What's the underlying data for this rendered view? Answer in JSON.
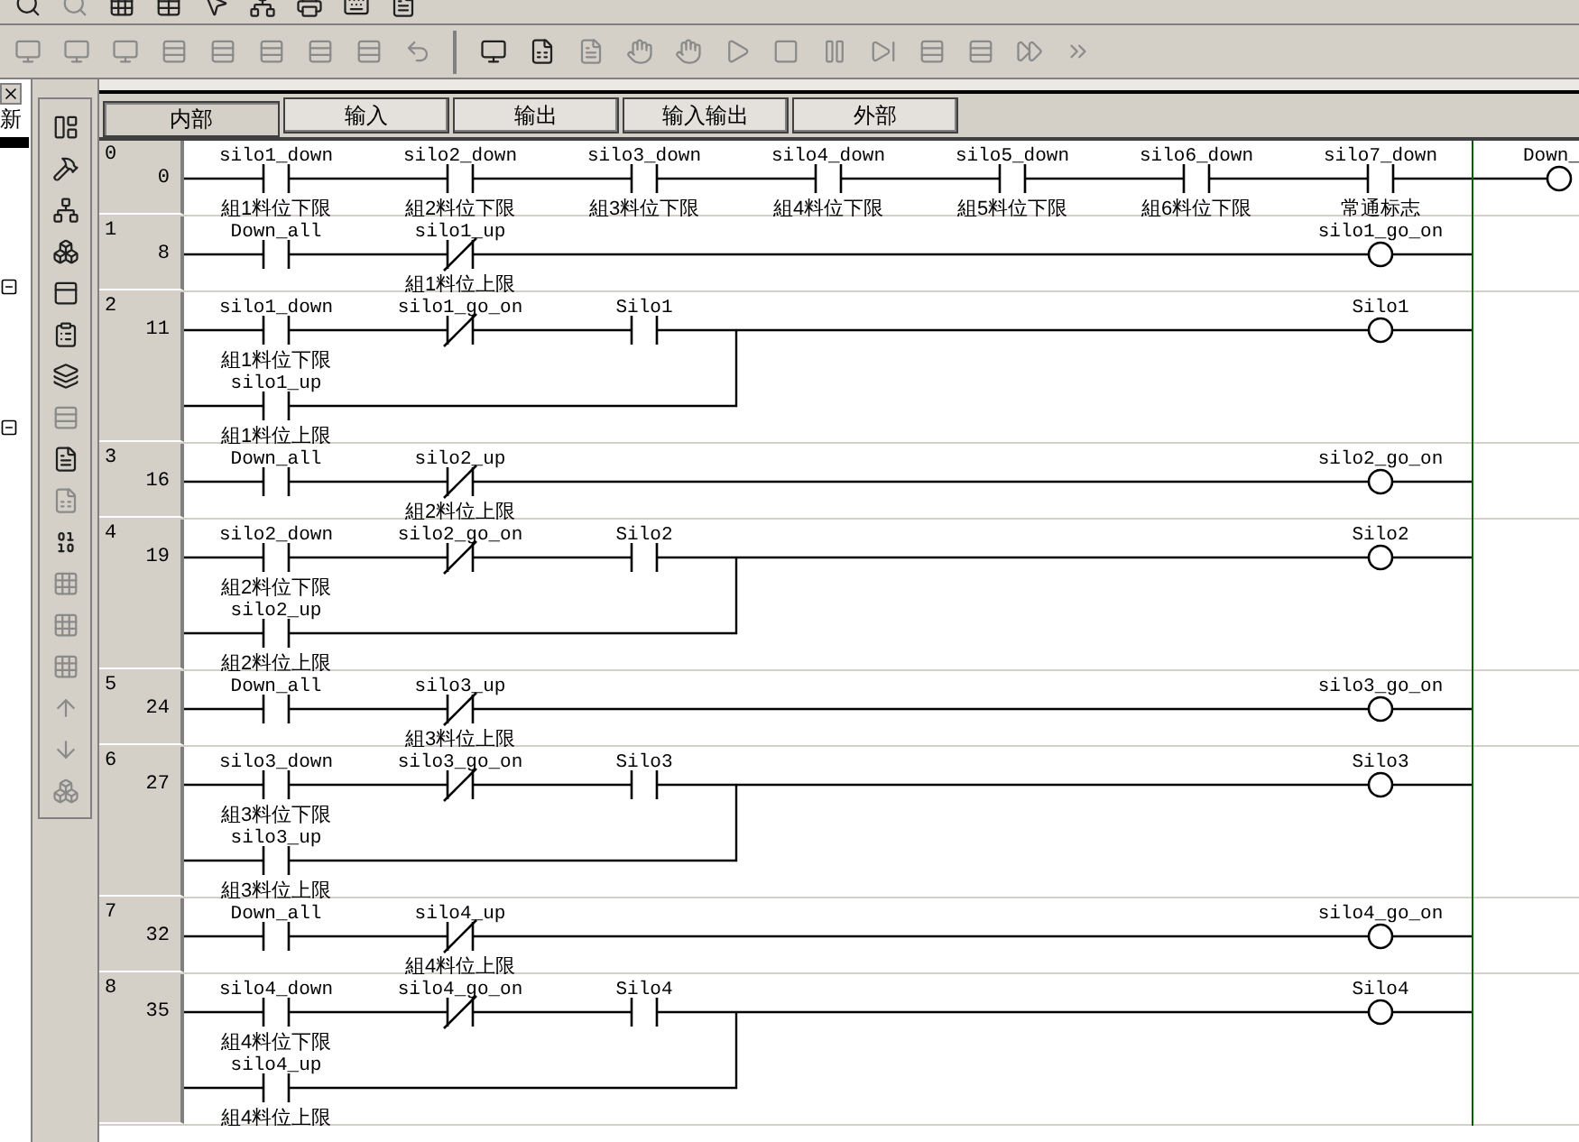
{
  "left_panel": {
    "label": "新"
  },
  "tabs": [
    {
      "label": "内部",
      "selected": true
    },
    {
      "label": "输入",
      "selected": false
    },
    {
      "label": "输出",
      "selected": false
    },
    {
      "label": "输入输出",
      "selected": false
    },
    {
      "label": "外部",
      "selected": false
    }
  ],
  "rungs": [
    {
      "number": "0",
      "step": "0",
      "contacts": [
        {
          "kind": "no",
          "label": "silo1_down",
          "comment": "組1料位下限"
        },
        {
          "kind": "no",
          "label": "silo2_down",
          "comment": "組2料位下限"
        },
        {
          "kind": "no",
          "label": "silo3_down",
          "comment": "組3料位下限"
        },
        {
          "kind": "no",
          "label": "silo4_down",
          "comment": "組4料位下限"
        },
        {
          "kind": "no",
          "label": "silo5_down",
          "comment": "組5料位下限"
        },
        {
          "kind": "no",
          "label": "silo6_down",
          "comment": "組6料位下限"
        },
        {
          "kind": "no",
          "label": "silo7_down",
          "comment": "常通标志"
        }
      ],
      "coil": {
        "label": "Down_"
      }
    },
    {
      "number": "1",
      "step": "8",
      "contacts": [
        {
          "kind": "no",
          "label": "Down_all"
        },
        {
          "kind": "nc",
          "label": "silo1_up",
          "comment": "組1料位上限"
        }
      ],
      "coil": {
        "label": "silo1_go_on"
      }
    },
    {
      "number": "2",
      "step": "11",
      "contacts": [
        {
          "kind": "no",
          "label": "silo1_down",
          "comment": "組1料位下限"
        },
        {
          "kind": "nc",
          "label": "silo1_go_on"
        },
        {
          "kind": "no",
          "label": "Silo1"
        }
      ],
      "branch": {
        "kind": "no",
        "label": "silo1_up",
        "comment": "組1料位上限"
      },
      "coil": {
        "label": "Silo1"
      }
    },
    {
      "number": "3",
      "step": "16",
      "contacts": [
        {
          "kind": "no",
          "label": "Down_all"
        },
        {
          "kind": "nc",
          "label": "silo2_up",
          "comment": "組2料位上限"
        }
      ],
      "coil": {
        "label": "silo2_go_on"
      }
    },
    {
      "number": "4",
      "step": "19",
      "contacts": [
        {
          "kind": "no",
          "label": "silo2_down",
          "comment": "組2料位下限"
        },
        {
          "kind": "nc",
          "label": "silo2_go_on"
        },
        {
          "kind": "no",
          "label": "Silo2"
        }
      ],
      "branch": {
        "kind": "no",
        "label": "silo2_up",
        "comment": "組2料位上限"
      },
      "coil": {
        "label": "Silo2"
      }
    },
    {
      "number": "5",
      "step": "24",
      "contacts": [
        {
          "kind": "no",
          "label": "Down_all"
        },
        {
          "kind": "nc",
          "label": "silo3_up",
          "comment": "組3料位上限"
        }
      ],
      "coil": {
        "label": "silo3_go_on"
      }
    },
    {
      "number": "6",
      "step": "27",
      "contacts": [
        {
          "kind": "no",
          "label": "silo3_down",
          "comment": "組3料位下限"
        },
        {
          "kind": "nc",
          "label": "silo3_go_on"
        },
        {
          "kind": "no",
          "label": "Silo3"
        }
      ],
      "branch": {
        "kind": "no",
        "label": "silo3_up",
        "comment": "組3料位上限"
      },
      "coil": {
        "label": "Silo3"
      }
    },
    {
      "number": "7",
      "step": "32",
      "contacts": [
        {
          "kind": "no",
          "label": "Down_all"
        },
        {
          "kind": "nc",
          "label": "silo4_up",
          "comment": "組4料位上限"
        }
      ],
      "coil": {
        "label": "silo4_go_on"
      }
    },
    {
      "number": "8",
      "step": "35",
      "contacts": [
        {
          "kind": "no",
          "label": "silo4_down",
          "comment": "組4料位下限"
        },
        {
          "kind": "nc",
          "label": "silo4_go_on"
        },
        {
          "kind": "no",
          "label": "Silo4"
        }
      ],
      "branch": {
        "kind": "no",
        "label": "silo4_up",
        "comment": "組4料位上限"
      },
      "coil": {
        "label": "Silo4"
      }
    }
  ]
}
